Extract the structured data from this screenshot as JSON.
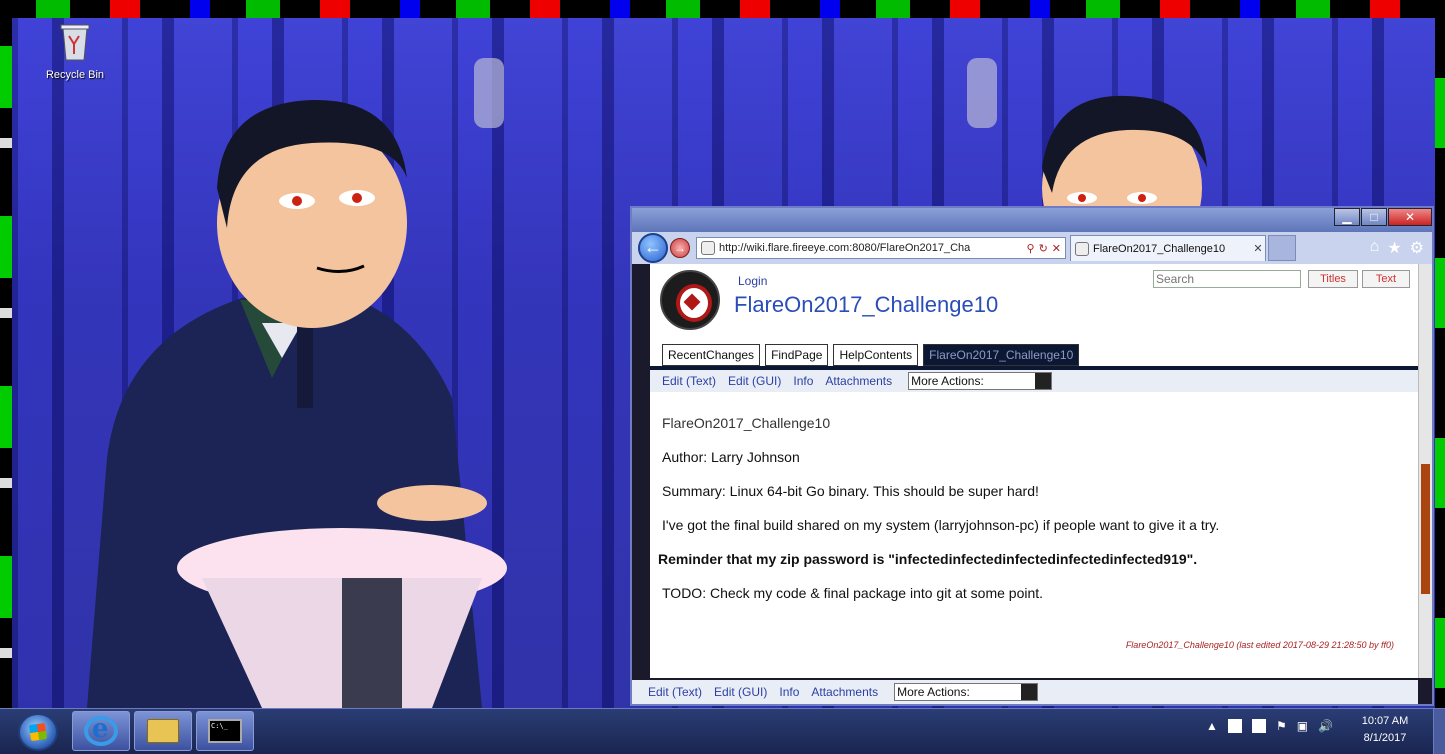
{
  "desktop": {
    "recycle_bin_label": "Recycle Bin"
  },
  "browser": {
    "address": "http://wiki.flare.fireeye.com:8080/FlareOn2017_Cha",
    "tab_title": "FlareOn2017_Challenge10",
    "window_buttons": {
      "minimize": "▁",
      "maximize": "□",
      "close": "✕"
    },
    "back": "←",
    "forward": "→",
    "tools": {
      "home": "⌂",
      "favorites": "★",
      "settings": "⚙"
    },
    "addr_tools": {
      "search": "⚲",
      "refresh": "↻",
      "stop": "✕"
    }
  },
  "wiki": {
    "login": "Login",
    "title": "FlareOn2017_Challenge10",
    "search_placeholder": "Search",
    "titles_button": "Titles",
    "text_button": "Text",
    "nav_tabs": [
      "RecentChanges",
      "FindPage",
      "HelpContents",
      "FlareOn2017_Challenge10"
    ],
    "edit_links": [
      "Edit (Text)",
      "Edit (GUI)",
      "Info",
      "Attachments"
    ],
    "more_actions": "More Actions:",
    "page_name": "FlareOn2017_Challenge10",
    "author": "Author: Larry Johnson",
    "summary": "Summary: Linux 64-bit Go binary. This should be super hard!",
    "build_note": "I've got the final build shared on my system (larryjohnson-pc) if people want to give it a try.",
    "reminder": "Reminder that my zip password is \"infectedinfectedinfectedinfectedinfected919\".",
    "todo": "TODO: Check my code & final package into git at some point.",
    "footer": "FlareOn2017_Challenge10 (last edited 2017-08-29 21:28:50 by ff0)"
  },
  "taskbar": {
    "time": "10:07 AM",
    "date": "8/1/2017",
    "tray_up": "▲",
    "tray_flag": "⚑",
    "tray_network": "▣",
    "tray_volume": "🔊",
    "cmd_label": "C:\\_"
  },
  "colors": {
    "wallpaper": "#2d2fb8",
    "link": "#2b3fa3",
    "title": "#2a4db8"
  }
}
